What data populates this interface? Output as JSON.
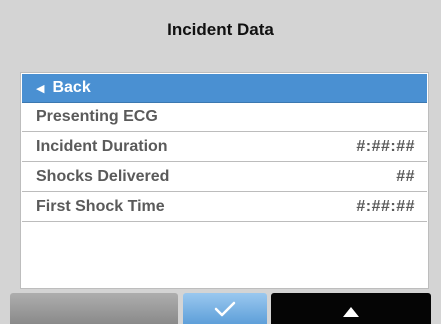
{
  "header": {
    "title": "Incident Data"
  },
  "menu": {
    "back_label": "Back",
    "items": [
      {
        "label": "Presenting ECG",
        "value": ""
      },
      {
        "label": "Incident Duration",
        "value": "#:##:##"
      },
      {
        "label": "Shocks Delivered",
        "value": "##"
      },
      {
        "label": "First Shock Time",
        "value": "#:##:##"
      }
    ]
  },
  "icons": {
    "back": "left-arrow-icon",
    "confirm": "checkmark-icon",
    "up": "up-triangle-icon"
  },
  "colors": {
    "selection": "#4a90d2",
    "background": "#d4d4d4",
    "confirm_key": "#6aa8de",
    "right_key": "#050505",
    "left_key": "#9a9a9a"
  }
}
